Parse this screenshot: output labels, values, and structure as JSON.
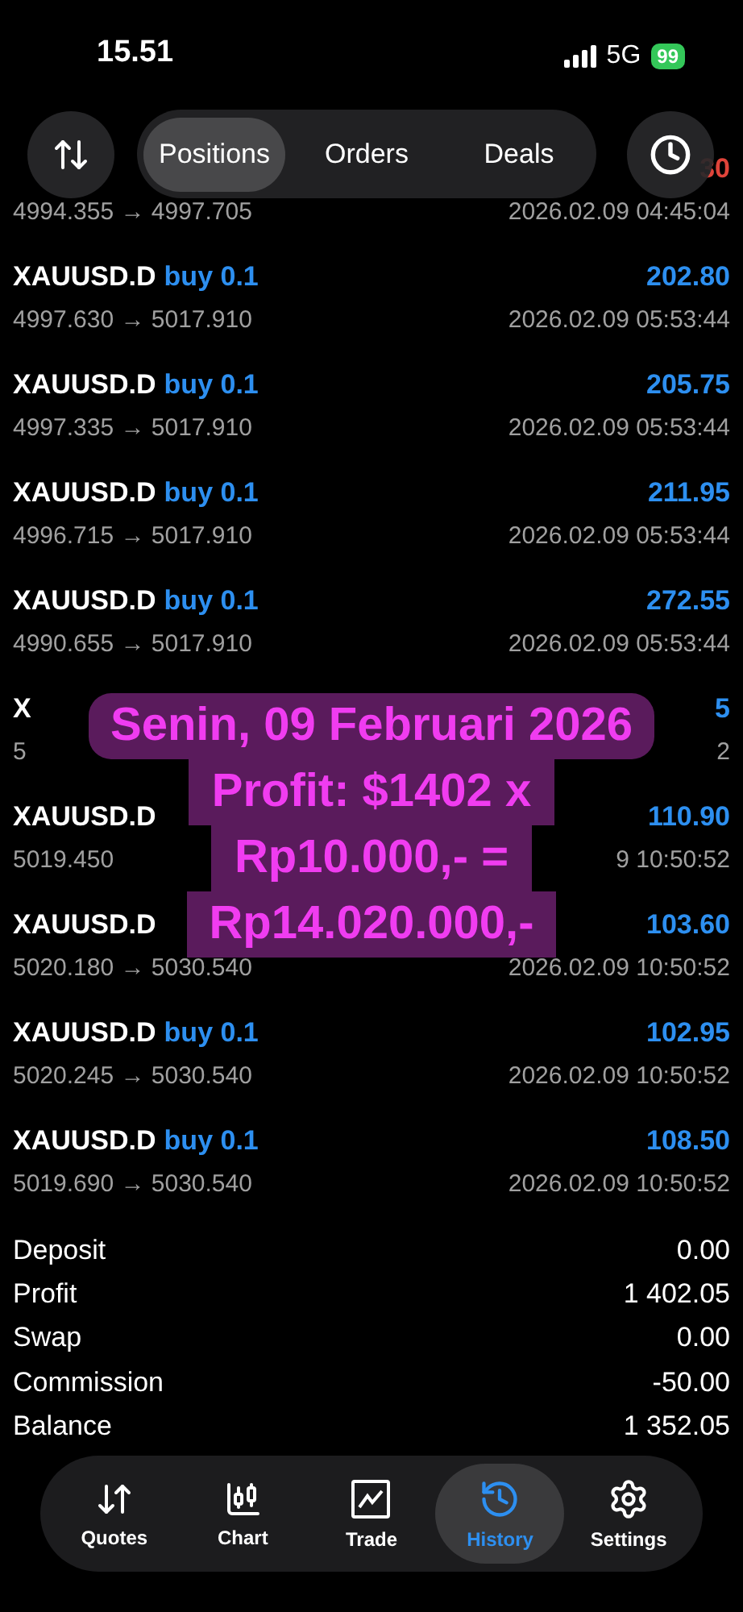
{
  "status_bar": {
    "time": "15.51",
    "network": "5G",
    "battery": "99"
  },
  "toolbar": {
    "tabs": [
      {
        "label": "Positions",
        "selected": true
      },
      {
        "label": "Orders",
        "selected": false
      },
      {
        "label": "Deals",
        "selected": false
      }
    ]
  },
  "deals": [
    {
      "profit": "30",
      "loss": true,
      "prices": "4994.355 → 4997.705",
      "time": "2026.02.09 04:45:04"
    },
    {
      "symbol": "XAUUSD.D",
      "side": "buy 0.1",
      "profit": "202.80",
      "loss": false,
      "prices": "4997.630 → 5017.910",
      "time": "2026.02.09 05:53:44"
    },
    {
      "symbol": "XAUUSD.D",
      "side": "buy 0.1",
      "profit": "205.75",
      "loss": false,
      "prices": "4997.335 → 5017.910",
      "time": "2026.02.09 05:53:44"
    },
    {
      "symbol": "XAUUSD.D",
      "side": "buy 0.1",
      "profit": "211.95",
      "loss": false,
      "prices": "4996.715 → 5017.910",
      "time": "2026.02.09 05:53:44"
    },
    {
      "symbol": "XAUUSD.D",
      "side": "buy 0.1",
      "profit": "272.55",
      "loss": false,
      "prices": "4990.655 → 5017.910",
      "time": "2026.02.09 05:53:44"
    },
    {
      "symbol": "X",
      "profit": "5",
      "loss": false,
      "prices": "5",
      "time": "2"
    },
    {
      "symbol": "XAUUSD.D",
      "profit": "110.90",
      "loss": false,
      "prices": "5019.450",
      "time": "9 10:50:52"
    },
    {
      "symbol": "XAUUSD.D",
      "profit": "103.60",
      "loss": false,
      "prices": "5020.180 → 5030.540",
      "time": "2026.02.09 10:50:52"
    },
    {
      "symbol": "XAUUSD.D",
      "side": "buy 0.1",
      "profit": "102.95",
      "loss": false,
      "prices": "5020.245 → 5030.540",
      "time": "2026.02.09 10:50:52"
    },
    {
      "symbol": "XAUUSD.D",
      "side": "buy 0.1",
      "profit": "108.50",
      "loss": false,
      "prices": "5019.690 → 5030.540",
      "time": "2026.02.09 10:50:52"
    }
  ],
  "summary": [
    {
      "label": "Deposit",
      "value": "0.00"
    },
    {
      "label": "Profit",
      "value": "1 402.05"
    },
    {
      "label": "Swap",
      "value": "0.00"
    },
    {
      "label": "Commission",
      "value": "-50.00"
    },
    {
      "label": "Balance",
      "value": "1 352.05"
    }
  ],
  "caption": {
    "lines": [
      "Senin, 09 Februari 2026",
      "Profit: $1402 x",
      "Rp10.000,- =",
      "Rp14.020.000,-"
    ]
  },
  "nav": [
    {
      "kind": "quotes",
      "label": "Quotes",
      "selected": false
    },
    {
      "kind": "chart",
      "label": "Chart",
      "selected": false
    },
    {
      "kind": "trade",
      "label": "Trade",
      "selected": false
    },
    {
      "kind": "history",
      "label": "History",
      "selected": true
    },
    {
      "kind": "settings",
      "label": "Settings",
      "selected": false
    }
  ]
}
